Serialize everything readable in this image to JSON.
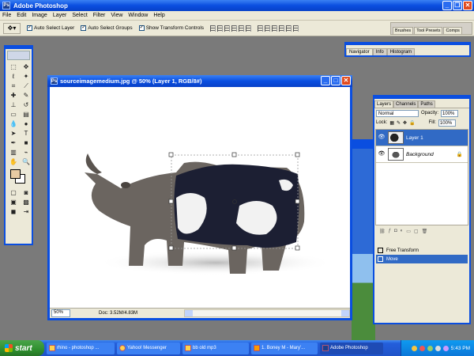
{
  "app": {
    "title": "Adobe Photoshop",
    "logo_text": "Ps"
  },
  "menu": [
    "File",
    "Edit",
    "Image",
    "Layer",
    "Select",
    "Filter",
    "View",
    "Window",
    "Help"
  ],
  "options": {
    "auto_select_layer": "Auto Select Layer",
    "auto_select_groups": "Auto Select Groups",
    "show_transform_controls": "Show Transform Controls",
    "well_tabs": [
      "Brushes",
      "Tool Presets",
      "Comps"
    ]
  },
  "navigator": {
    "tabs": [
      "Navigator",
      "Info",
      "Histogram"
    ]
  },
  "document": {
    "title": "sourceimagemedium.jpg @ 50% (Layer 1, RGB/8#)",
    "zoom": "50%",
    "doc_info": "Doc: 3.52M/4.83M"
  },
  "layers_panel": {
    "tabs": [
      "Layers",
      "Channels",
      "Paths"
    ],
    "blend_mode": "Normal",
    "opacity_label": "Opacity:",
    "opacity": "100%",
    "lock_label": "Lock:",
    "fill_label": "Fill:",
    "fill": "100%",
    "layers": [
      {
        "name": "Layer 1",
        "active": true
      },
      {
        "name": "Background",
        "active": false
      }
    ]
  },
  "history": {
    "items": [
      "Free Transform",
      "Move"
    ]
  },
  "taskbar": {
    "start": "start",
    "tasks": [
      "rhino - photoshop ...",
      "Yahoo! Messenger",
      "bb old mp3",
      "1. Boney M - Mary'...",
      "Adobe Photoshop"
    ],
    "clock": "5:43 PM"
  },
  "colors": {
    "xp_blue": "#0a4ee0",
    "foreground_swatch": "#e8cba3",
    "background_swatch": "#ffffff",
    "selection": "#316ac5"
  }
}
